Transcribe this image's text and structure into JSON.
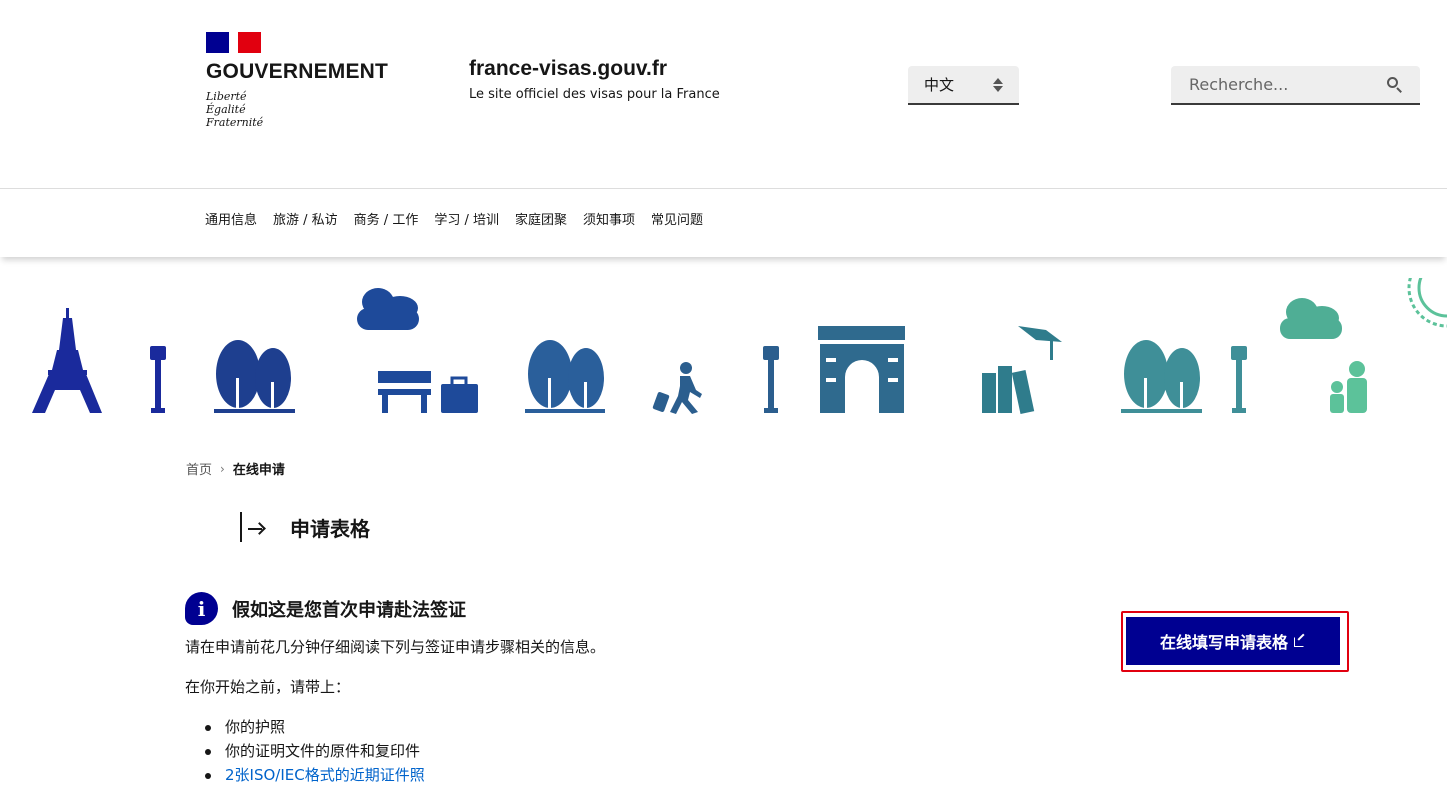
{
  "header": {
    "gov_title": "GOUVERNEMENT",
    "motto": [
      "Liberté",
      "Égalité",
      "Fraternité"
    ],
    "site_name": "france-visas.gouv.fr",
    "site_tagline": "Le site officiel des visas pour la France",
    "language": "中文",
    "search_placeholder": "Recherche..."
  },
  "nav": {
    "items": [
      "通用信息",
      "旅游 / 私访",
      "商务 / 工作",
      "学习 / 培训",
      "家庭团聚",
      "须知事项",
      "常见问题"
    ]
  },
  "breadcrumb": {
    "home": "首页",
    "separator": "›",
    "current": "在线申请"
  },
  "main": {
    "title": "申请表格",
    "info_heading": "假如这是您首次申请赴法签证",
    "info_icon": "i",
    "paragraph1": "请在申请前花几分钟仔细阅读下列与签证申请步骤相关的信息。",
    "paragraph2": "在你开始之前，请带上：",
    "items": [
      "你的护照",
      "你的证明文件的原件和复印件",
      "2张ISO/IEC格式的近期证件照"
    ],
    "cta_label": "在线填写申请表格"
  },
  "colors": {
    "brand_blue": "#000091",
    "brand_red": "#e1000f",
    "link": "#0063cb",
    "banner_blue": "#1e3a8a",
    "banner_teal": "#2f7c8c",
    "banner_green": "#5cc29a"
  },
  "icons": [
    "search-icon",
    "chevron-updown-icon",
    "info-icon",
    "external-link-icon",
    "arrow-right-icon"
  ]
}
